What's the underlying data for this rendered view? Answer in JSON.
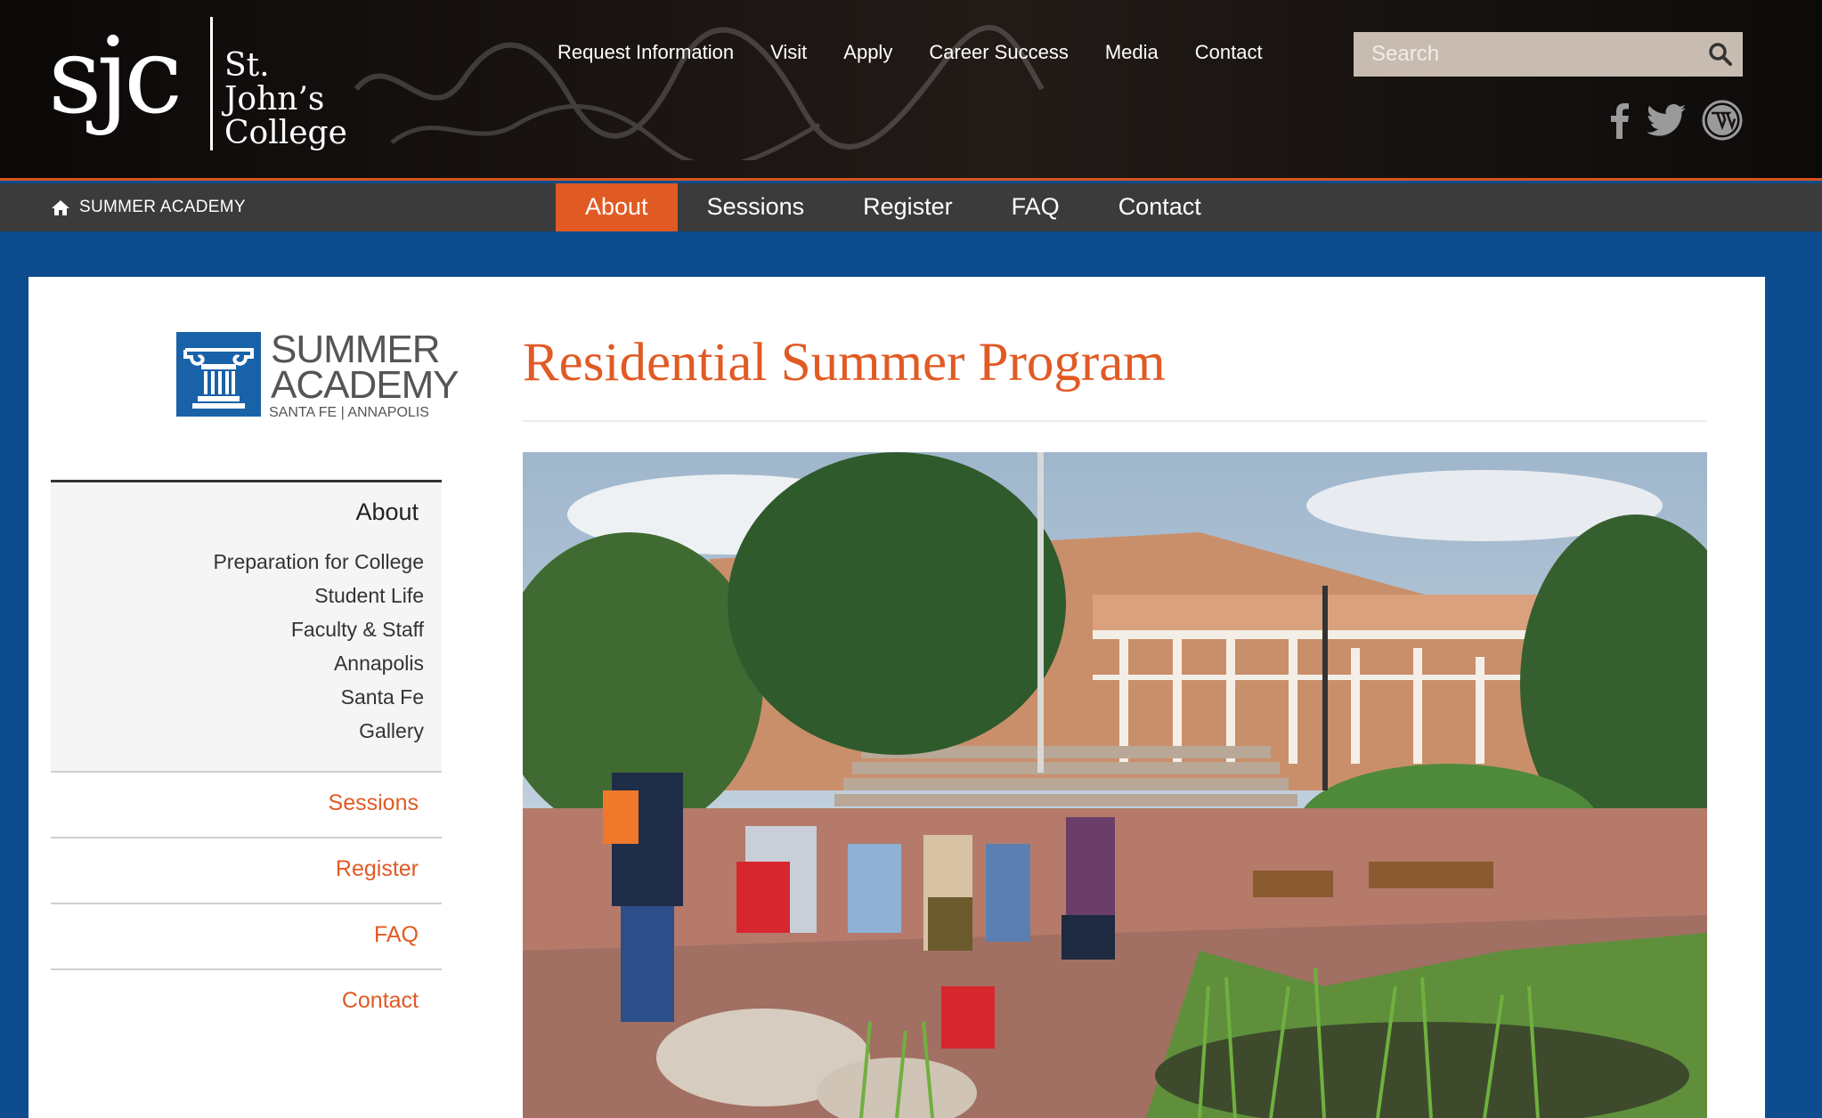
{
  "header": {
    "logo": {
      "mark": "sjc",
      "name_line1": "St. John’s",
      "name_line2": "College"
    },
    "top_nav": [
      "Request Information",
      "Visit",
      "Apply",
      "Career Success",
      "Media",
      "Contact"
    ],
    "search": {
      "placeholder": "Search",
      "icon": "search-icon"
    },
    "social": [
      "facebook-icon",
      "twitter-icon",
      "wordpress-icon"
    ]
  },
  "subnav": {
    "home_label": "SUMMER ACADEMY",
    "tabs": [
      "About",
      "Sessions",
      "Register",
      "FAQ",
      "Contact"
    ],
    "active_tab": "About"
  },
  "sidebar": {
    "logo": {
      "title_line1": "SUMMER",
      "title_line2": "ACADEMY",
      "subtitle": "SANTA FE | ANNAPOLIS"
    },
    "about": {
      "heading": "About",
      "items": [
        "Preparation for College",
        "Student Life",
        "Faculty & Staff",
        "Annapolis",
        "Santa Fe",
        "Gallery"
      ]
    },
    "links": [
      "Sessions",
      "Register",
      "FAQ",
      "Contact"
    ]
  },
  "main": {
    "title": "Residential Summer Program"
  },
  "colors": {
    "accent": "#e15a24",
    "background_blue": "#0d4d8f",
    "subnav_bg": "#3b3b3b",
    "header_bg": "#161210"
  }
}
